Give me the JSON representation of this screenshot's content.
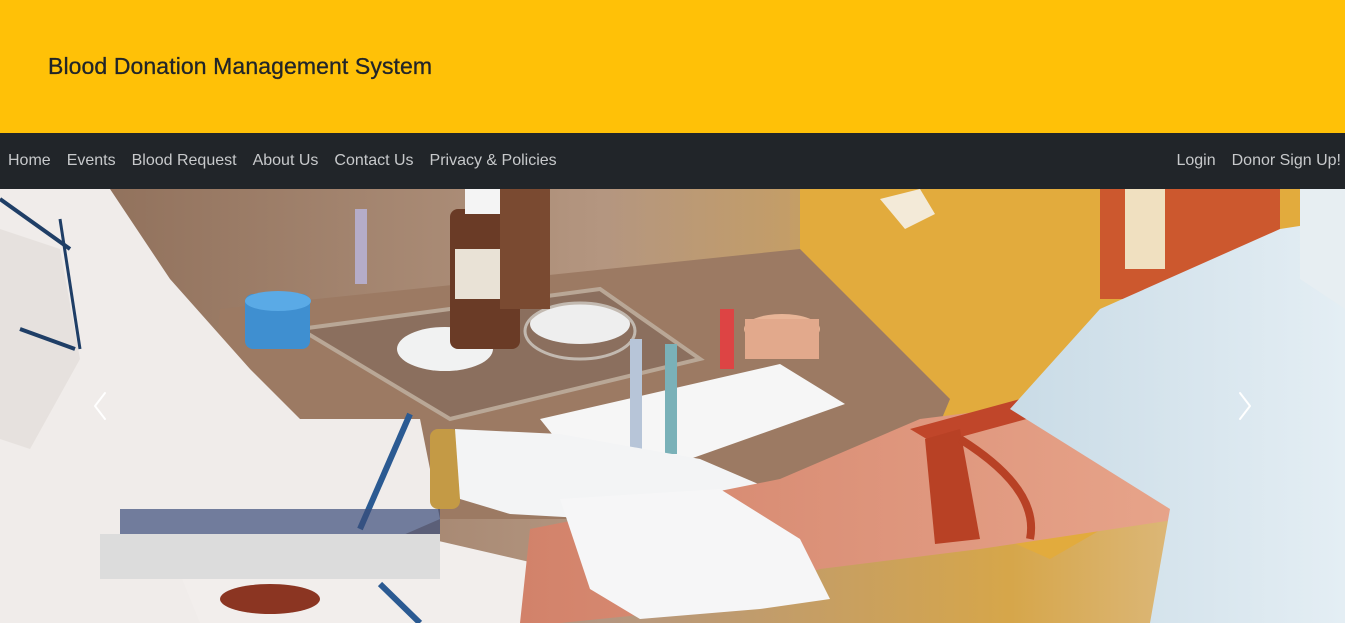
{
  "header": {
    "title": "Blood Donation Management System",
    "background": "#ffc107"
  },
  "nav": {
    "background": "#212529",
    "left": [
      {
        "label": "Home"
      },
      {
        "label": "Events"
      },
      {
        "label": "Blood Request"
      },
      {
        "label": "About Us"
      },
      {
        "label": "Contact Us"
      },
      {
        "label": "Privacy & Policies"
      }
    ],
    "right": [
      {
        "label": "Login"
      },
      {
        "label": "Donor Sign Up!"
      }
    ]
  },
  "carousel": {
    "image": "blood-donation-photo",
    "prev_icon": "chevron-left-icon",
    "next_icon": "chevron-right-icon"
  }
}
